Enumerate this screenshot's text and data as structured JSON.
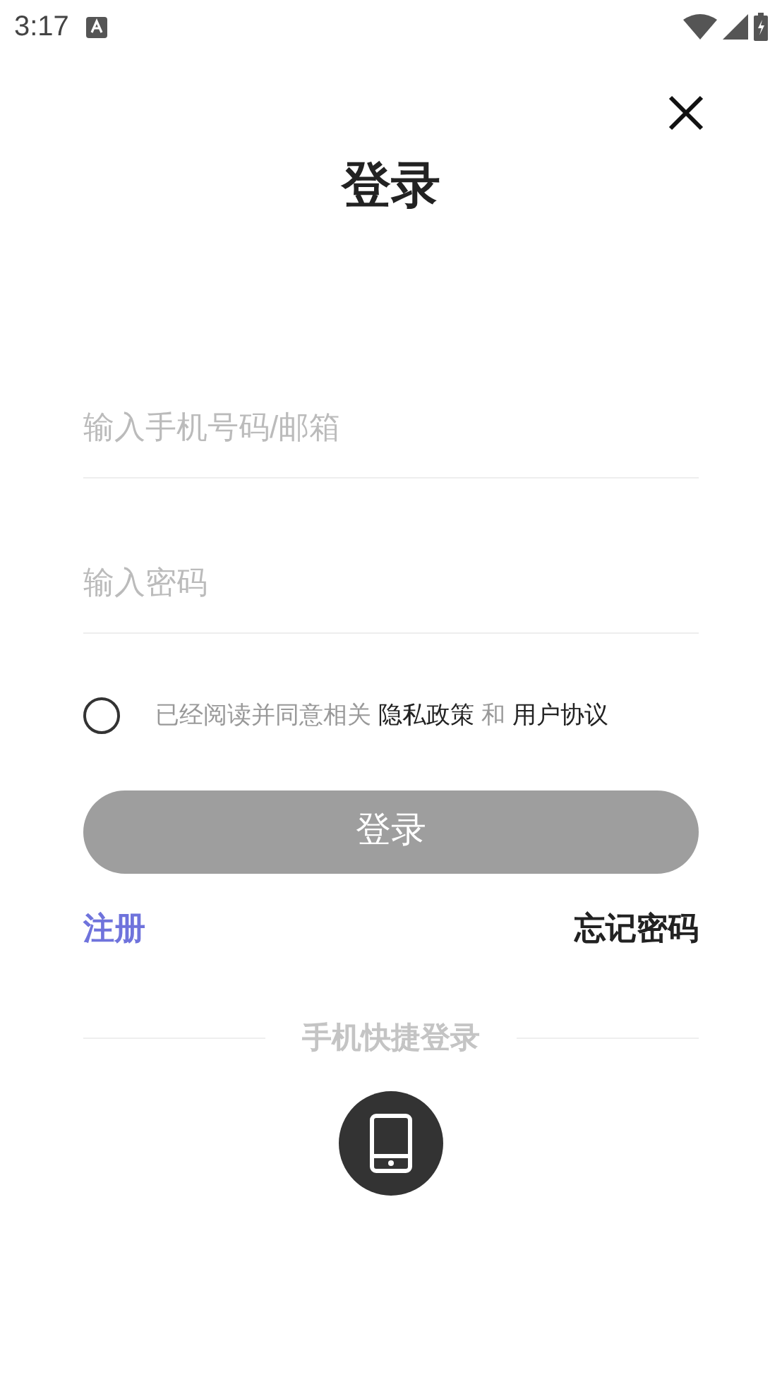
{
  "status_bar": {
    "time": "3:17"
  },
  "header": {
    "title": "登录"
  },
  "fields": [
    {
      "placeholder": "输入手机号码/邮箱"
    },
    {
      "placeholder": "输入密码"
    }
  ],
  "agreement": {
    "checked": false,
    "parts": [
      {
        "text": "已经阅读并同意相关",
        "kind": "plain"
      },
      {
        "text": "隐私政策",
        "kind": "link"
      },
      {
        "text": "和",
        "kind": "plain"
      },
      {
        "text": "用户协议",
        "kind": "link"
      }
    ]
  },
  "login_button": {
    "label": "登录",
    "disabled": true
  },
  "links": {
    "register": "注册",
    "forgot": "忘记密码"
  },
  "quick_login": {
    "label": "手机快捷登录"
  }
}
